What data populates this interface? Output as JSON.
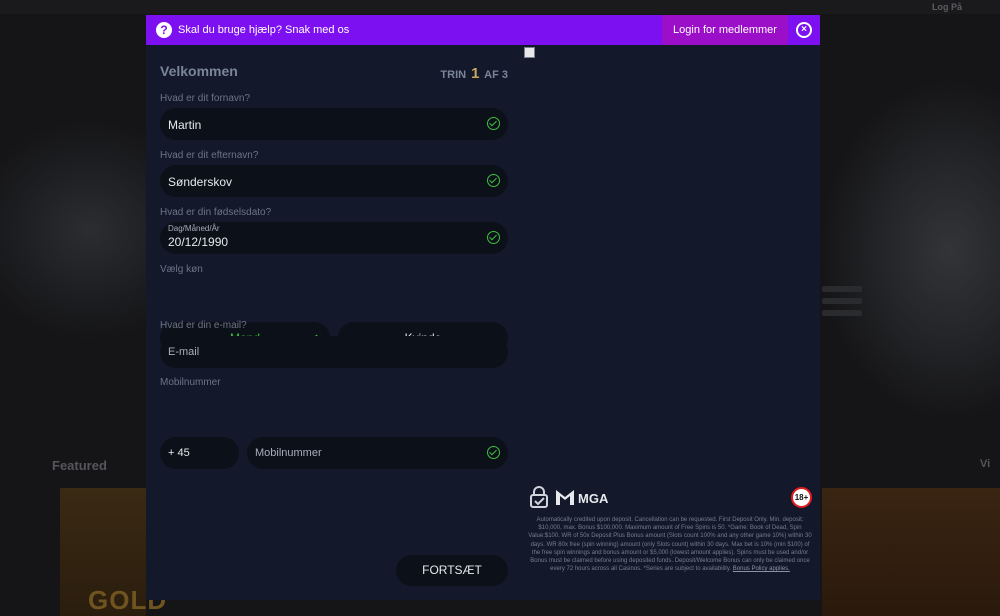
{
  "background": {
    "header_login": "Log På",
    "featured_label": "Featured",
    "right_label": "Vi",
    "tile_text": "GOLD"
  },
  "topbar": {
    "help_icon": "?",
    "help_text": "Skal du bruge hjælp? Snak med os",
    "login_label": "Login for medlemmer",
    "close_icon": "×"
  },
  "form": {
    "title": "Velkommen",
    "step": {
      "prefix": "TRIN",
      "current": "1",
      "suffix": "AF 3"
    },
    "first_name": {
      "label": "Hvad er dit fornavn?",
      "value": "Martin"
    },
    "last_name": {
      "label": "Hvad er dit efternavn?",
      "value": "Sønderskov"
    },
    "birthdate": {
      "label": "Hvad er din fødselsdato?",
      "hint": "Dag/Måned/År",
      "value": "20/12/1990"
    },
    "gender": {
      "label": "Vælg køn",
      "male": "Mand",
      "female": "Kvinde",
      "selected": "Mand"
    },
    "email": {
      "label": "Hvad er din e-mail?",
      "placeholder": "E-mail"
    },
    "mobile": {
      "label": "Mobilnummer",
      "prefix": "+ 45",
      "placeholder": "Mobilnummer"
    },
    "continue_label": "FORTSÆT"
  },
  "side_panel": {
    "mga_label": "MGA",
    "age_label": "18+",
    "terms": "Automatically credited upon deposit. Cancellation can be requested. First Deposit Only. Min. deposit: $10,000, max. Bonus $100,000. Maximum amount of Free Spins is 50. *Game: Book of Dead, Spin Value:$100. WR of 50x Deposit Plus Bonus amount (Slots count 100% and any other game 10%) within 30 days. WR 80x free (spin winning) amount (only Slots count) within 30 days. Max bet is 10% (min $100) of the free spin winnings and bonus amount or $5,000 (lowest amount applies). Spins must be used and/or Bonus must be claimed before using deposited funds. Deposit/Welcome Bonus can only be claimed once every 72 hours across all Casinos. *Series are subject to availability.",
    "terms_link": "Bonus Policy applies."
  },
  "colors": {
    "topbar": "#7c10f0",
    "login_bg": "#9c0fc8",
    "modal_bg": "#13192a",
    "field_bg": "#0c1019",
    "success": "#3ec13e",
    "step_accent": "#c6a55e"
  }
}
